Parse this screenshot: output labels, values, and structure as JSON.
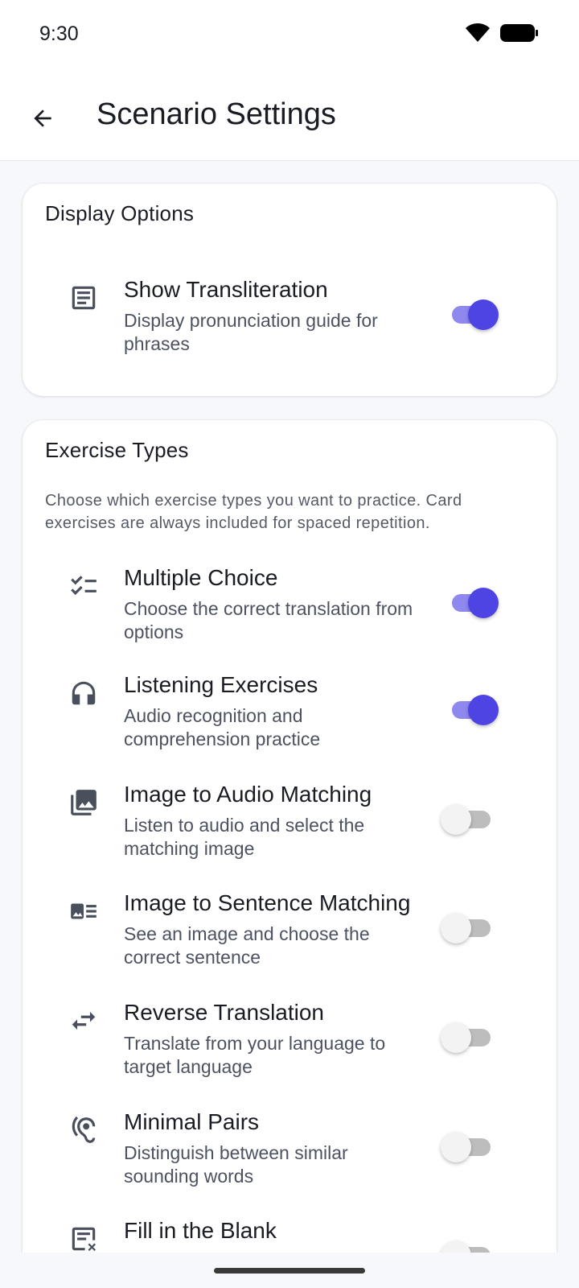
{
  "status_bar": {
    "time": "9:30",
    "icons": [
      "wifi-icon",
      "battery-icon"
    ]
  },
  "app_bar": {
    "back_icon": "arrow-back-icon",
    "title": "Scenario Settings"
  },
  "display_options": {
    "title": "Display Options",
    "items": [
      {
        "icon": "article-icon",
        "title": "Show Transliteration",
        "subtitle": "Display pronunciation guide for phrases",
        "enabled": true
      }
    ]
  },
  "exercise_types": {
    "title": "Exercise Types",
    "description": "Choose which exercise types you want to practice. Card exercises are always included for spaced repetition.",
    "items": [
      {
        "icon": "checklist-icon",
        "title": "Multiple Choice",
        "subtitle": "Choose the correct translation from options",
        "enabled": true
      },
      {
        "icon": "headphones-icon",
        "title": "Listening Exercises",
        "subtitle": "Audio recognition and comprehension practice",
        "enabled": true
      },
      {
        "icon": "photo-library-icon",
        "title": "Image to Audio Matching",
        "subtitle": "Listen to audio and select the matching image",
        "enabled": false
      },
      {
        "icon": "image-text-icon",
        "title": "Image to Sentence Matching",
        "subtitle": "See an image and choose the correct sentence",
        "enabled": false
      },
      {
        "icon": "swap-arrows-icon",
        "title": "Reverse Translation",
        "subtitle": "Translate from your language to target language",
        "enabled": false
      },
      {
        "icon": "hearing-icon",
        "title": "Minimal Pairs",
        "subtitle": "Distinguish between similar sounding words",
        "enabled": false
      },
      {
        "icon": "fill-blank-icon",
        "title": "Fill in the Blank",
        "subtitle": "",
        "enabled": false
      }
    ]
  },
  "colors": {
    "accent": "#4d44e3",
    "accent_track": "#8f88ee",
    "background": "#f6f8fb",
    "card": "#ffffff",
    "text_primary": "#1a1c24",
    "text_secondary": "#4d5261"
  }
}
